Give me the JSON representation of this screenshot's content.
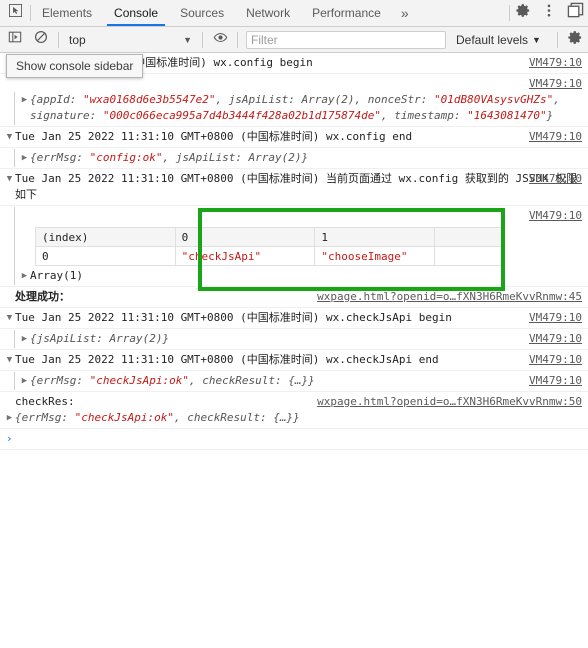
{
  "tabbar": {
    "inspect_icon": "inspect-cursor-icon",
    "tabs": [
      {
        "label": "Elements",
        "active": false
      },
      {
        "label": "Console",
        "active": true
      },
      {
        "label": "Sources",
        "active": false
      },
      {
        "label": "Network",
        "active": false
      },
      {
        "label": "Performance",
        "active": false
      }
    ],
    "more_label": "»",
    "settings_icon": "gear-icon",
    "menu_icon": "kebab-menu-icon",
    "dock_icon": "dock-panel-icon"
  },
  "toolbar": {
    "sidebar_toggle_icon": "show-console-sidebar-icon",
    "clear_icon": "clear-console-icon",
    "context": "top",
    "context_caret": "▼",
    "eye_icon": "live-expression-eye-icon",
    "filter_placeholder": "Filter",
    "filter_value": "",
    "levels_label": "Default levels",
    "levels_caret": "▼",
    "settings_icon": "console-settings-gear-icon"
  },
  "tooltip": {
    "text": "Show console sidebar"
  },
  "annotation": {
    "color": "#1aa519",
    "shape": "rectangle"
  },
  "messages": [
    {
      "id": "m1",
      "marker": "blank",
      "text": "1:31:10 GMT+0800 (中国标准时间) wx.config begin",
      "source": "VM479:10"
    },
    {
      "id": "m2",
      "marker": "closed",
      "kind": "object",
      "text": "{appId: \"wxa0168d6e3b5547e2\", jsApiList: Array(2), nonceStr: \"01dB80VAsysvGHZs\", signature: \"000c066eca995a7d4b3444f428a02b1d175874de\", timestamp: \"1643081470\"}",
      "source": "VM479:10"
    },
    {
      "id": "m3",
      "marker": "open",
      "text": "Tue Jan 25 2022 11:31:10 GMT+0800 (中国标准时间) wx.config end",
      "source": "VM479:10"
    },
    {
      "id": "m4",
      "marker": "closed",
      "kind": "object",
      "text": "{errMsg: \"config:ok\", jsApiList: Array(2)}",
      "source": ""
    },
    {
      "id": "m5",
      "marker": "open",
      "text": "Tue Jan 25 2022 11:31:10 GMT+0800 (中国标准时间) 当前页面通过 wx.config 获取到的 JSSDK 权限如下",
      "source": "VM479:10"
    },
    {
      "id": "m6",
      "marker": "blank",
      "kind": "table",
      "source": "VM479:10"
    },
    {
      "id": "m7",
      "marker": "closed",
      "text": "Array(1)",
      "source": ""
    },
    {
      "id": "m8",
      "marker": "blank",
      "kind": "cjk",
      "text": "处理成功：",
      "source": "wxpage.html?openid=o…fXN3H6RmeKvvRnmw:45"
    },
    {
      "id": "m9",
      "marker": "open",
      "text": "Tue Jan 25 2022 11:31:10 GMT+0800 (中国标准时间) wx.checkJsApi begin",
      "source": "VM479:10"
    },
    {
      "id": "m10",
      "marker": "closed",
      "kind": "object",
      "text": "{jsApiList: Array(2)}",
      "source": "VM479:10"
    },
    {
      "id": "m11",
      "marker": "open",
      "text": "Tue Jan 25 2022 11:31:10 GMT+0800 (中国标准时间) wx.checkJsApi end",
      "source": "VM479:10"
    },
    {
      "id": "m12",
      "marker": "closed",
      "kind": "object",
      "text": "{errMsg: \"checkJsApi:ok\", checkResult: {…}}",
      "source": "VM479:10"
    },
    {
      "id": "m13",
      "marker": "blank",
      "text": "checkRes:",
      "source": "wxpage.html?openid=o…fXN3H6RmeKvvRnmw:50"
    },
    {
      "id": "m14",
      "marker": "closed",
      "kind": "object",
      "text": "{errMsg: \"checkJsApi:ok\", checkResult: {…}}",
      "source": ""
    }
  ],
  "table": {
    "headers": [
      "(index)",
      "0",
      "1",
      ""
    ],
    "rows": [
      [
        "0",
        "\"checkJsApi\"",
        "\"chooseImage\"",
        ""
      ]
    ]
  },
  "prompt": {
    "arrow": "›",
    "value": ""
  }
}
